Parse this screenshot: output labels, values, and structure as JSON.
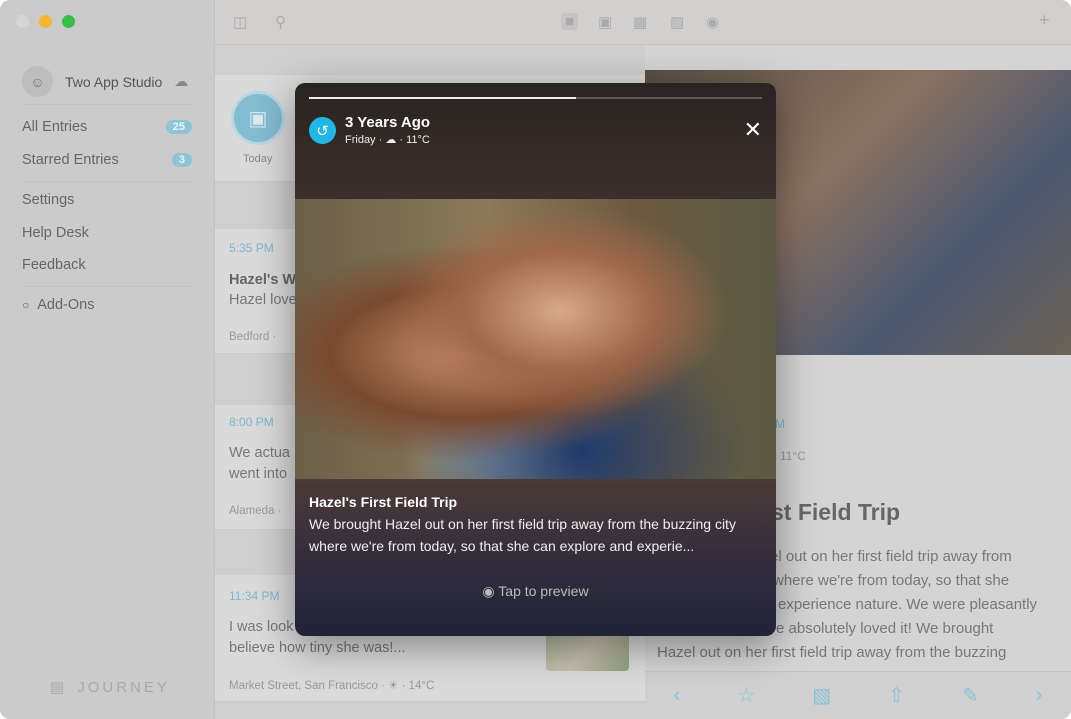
{
  "sidebar": {
    "account": "Two App Studio",
    "items": [
      {
        "label": "All Entries",
        "count": "25"
      },
      {
        "label": "Starred Entries",
        "count": "3"
      },
      {
        "label": "Settings"
      },
      {
        "label": "Help Desk"
      },
      {
        "label": "Feedback"
      },
      {
        "label": "Add-Ons"
      }
    ],
    "logo": "JOURNEY"
  },
  "list": {
    "today": "Today",
    "entries": [
      {
        "time": "5:35 PM",
        "title": "Hazel's W",
        "text": "Hazel love",
        "meta": "Bedford ·"
      },
      {
        "time": "8:00 PM",
        "text1": "We actua",
        "text2": "went into",
        "meta": "Alameda ·"
      },
      {
        "time": "11:34 PM",
        "text1": "I was look",
        "text2": "believe how tiny she was!...",
        "meta": "Market Street, San Francisco · ☀ · 14°C"
      }
    ]
  },
  "detail": {
    "time": "M",
    "weather": "11°C",
    "title": "st Field Trip",
    "lines": [
      "el out on her first field trip away from",
      "where we're from today, so that she",
      "experience nature. We were pleasantly",
      "e absolutely loved it! We brought",
      "Hazel out on her first field trip away from the buzzing"
    ]
  },
  "modal": {
    "title": "3 Years Ago",
    "subtitle": "Friday · ☁ · 11°C",
    "progress": 0.59,
    "entry_title": "Hazel's First Field Trip",
    "entry_body": "We brought Hazel out on her first field trip away from the buzzing city where we're from today, so that she can explore and experie...",
    "preview_label": "Tap to preview"
  },
  "colors": {
    "accent": "#1fb8e6",
    "badge": "#8ec4d8"
  }
}
